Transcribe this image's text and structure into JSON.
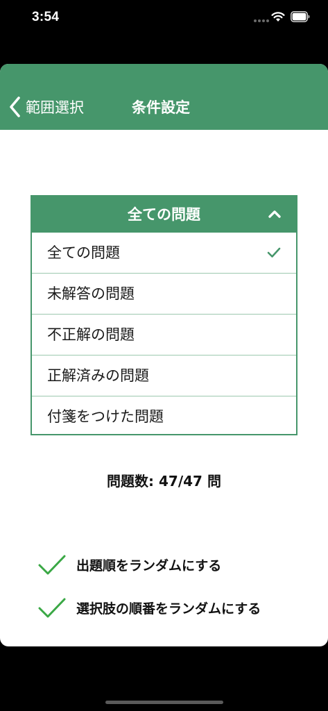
{
  "status_bar": {
    "time": "3:54",
    "wifi_icon": "wifi-icon",
    "battery_icon": "battery-icon"
  },
  "nav": {
    "back_label": "範囲選択",
    "back_icon": "chevron-left-icon",
    "title": "条件設定",
    "background_color": "#46966b"
  },
  "dropdown": {
    "selected_label": "全ての問題",
    "expanded": true,
    "toggle_icon": "chevron-up-icon",
    "options": [
      {
        "label": "全ての問題",
        "selected": true
      },
      {
        "label": "未解答の問題",
        "selected": false
      },
      {
        "label": "不正解の問題",
        "selected": false
      },
      {
        "label": "正解済みの問題",
        "selected": false
      },
      {
        "label": "付箋をつけた問題",
        "selected": false
      }
    ]
  },
  "question_count": "問題数: 47/47 問",
  "toggles": [
    {
      "label": "出題順をランダムにする",
      "checked": true,
      "icon": "check-icon"
    },
    {
      "label": "選択肢の順番をランダムにする",
      "checked": true,
      "icon": "check-icon"
    }
  ],
  "colors": {
    "accent": "#46966b",
    "check": "#3aa845",
    "divider": "#9cc8ae"
  }
}
